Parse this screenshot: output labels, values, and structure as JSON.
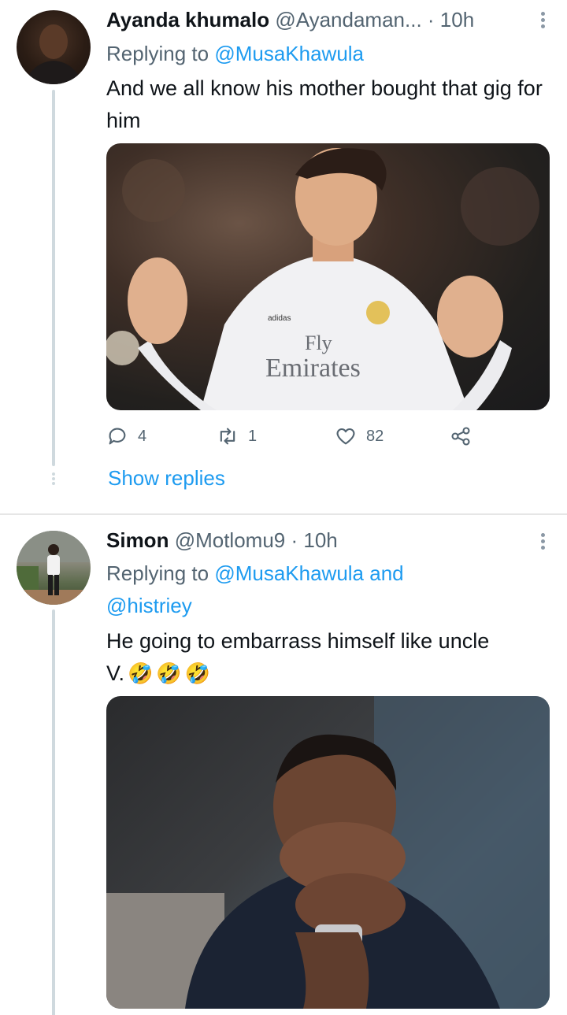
{
  "tweets": [
    {
      "name": "Ayanda khumalo",
      "handle": "@Ayandaman...",
      "time": "· 10h",
      "replying_prefix": "Replying to ",
      "replying_to": "@MusaKhawula",
      "text": "And we all know his mother bought that gig for him",
      "actions": {
        "replies": "4",
        "retweets": "1",
        "likes": "82"
      },
      "show_replies": "Show replies",
      "media_overlay": {
        "brand": "adidas",
        "sponsor_line1": "Fly",
        "sponsor_line2": "Emirates"
      }
    },
    {
      "name": "Simon",
      "handle": "@Motlomu9",
      "time": "· 10h",
      "replying_prefix": "Replying to ",
      "replying_to": "@MusaKhawula and",
      "replying_to_2": "@histriey",
      "text_line1": "He going to embarrass himself like uncle",
      "text_line2": "V.",
      "emojis": [
        "🤣",
        "🤣",
        "🤣"
      ]
    }
  ],
  "icons": {
    "reply": "reply-icon",
    "retweet": "retweet-icon",
    "like": "heart-icon",
    "share": "share-icon",
    "more": "more-vertical-icon"
  },
  "colors": {
    "link": "#1d9bf0",
    "secondary": "#536471",
    "thread": "#cfd9de"
  }
}
